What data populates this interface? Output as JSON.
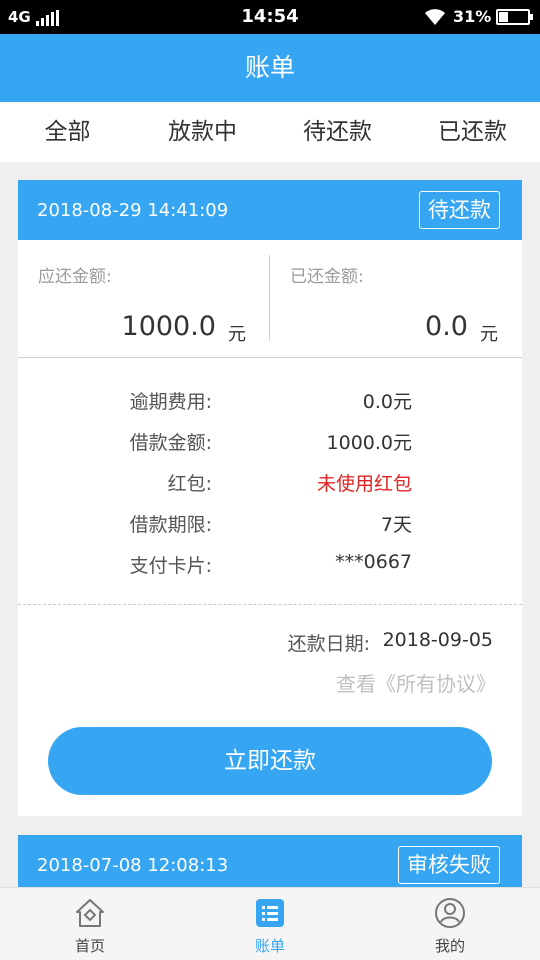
{
  "status_bar": {
    "network": "4G",
    "time": "14:54",
    "battery_percent": "31%",
    "battery_level": 0.31,
    "icons": [
      "signal-icon",
      "wifi-icon",
      "battery-icon"
    ]
  },
  "header": {
    "title": "账单"
  },
  "tabs": [
    {
      "label": "全部",
      "active": true
    },
    {
      "label": "放款中",
      "active": false
    },
    {
      "label": "待还款",
      "active": false
    },
    {
      "label": "已还款",
      "active": false
    }
  ],
  "bills": [
    {
      "datetime": "2018-08-29 14:41:09",
      "status": "待还款",
      "due_label": "应还金额:",
      "due_amount": "1000.0",
      "paid_label": "已还金额:",
      "paid_amount": "0.0",
      "currency": "元",
      "details": [
        {
          "label": "逾期费用:",
          "value": "0.0元",
          "highlight": false
        },
        {
          "label": "借款金额:",
          "value": "1000.0元",
          "highlight": false
        },
        {
          "label": "红包:",
          "value": "未使用红包",
          "highlight": true
        },
        {
          "label": "借款期限:",
          "value": "7天",
          "highlight": false
        },
        {
          "label": "支付卡片:",
          "value": "***0667",
          "highlight": false
        }
      ],
      "repay_date_label": "还款日期:",
      "repay_date": "2018-09-05",
      "agreements_link": "查看《所有协议》",
      "pay_button": "立即还款"
    },
    {
      "datetime": "2018-07-08 12:08:13",
      "status": "审核失败"
    }
  ],
  "bottom_nav": [
    {
      "label": "首页",
      "icon": "home-icon",
      "active": false
    },
    {
      "label": "账单",
      "icon": "bill-list-icon",
      "active": true
    },
    {
      "label": "我的",
      "icon": "profile-icon",
      "active": false
    }
  ],
  "colors": {
    "accent": "#36a6f2",
    "highlight_red": "#e02424",
    "status_bar": "#000000",
    "background": "#efefef"
  }
}
